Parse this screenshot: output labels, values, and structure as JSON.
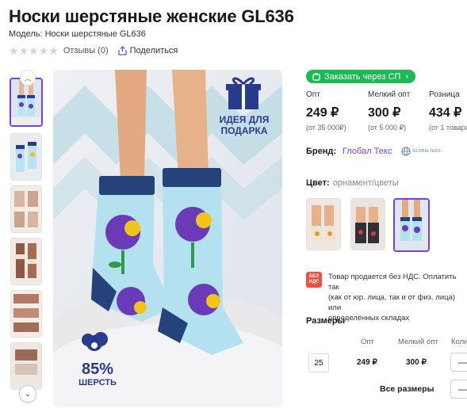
{
  "product": {
    "title": "Носки шерстяные женские GL636",
    "model": "Модель: Носки шерстяные GL636",
    "reviews": "Отзывы (0)",
    "share": "Поделиться",
    "rating_stars": 0
  },
  "gallery": {
    "thumbnail_count": 7,
    "up_icon": "chevron-up-icon",
    "down_icon": "chevron-down-icon"
  },
  "main_image": {
    "gift_text_line1": "ИДЕЯ ДЛЯ",
    "gift_text_line2": "ПОДАРКА",
    "wool_percent": "85%",
    "wool_label": "ШЕРСТЬ"
  },
  "order": {
    "sp_button": "Заказать через СП"
  },
  "prices": [
    {
      "label": "Опт",
      "value": "249 ₽",
      "note": "(от 35 000₽)"
    },
    {
      "label": "Мелкий опт",
      "value": "300 ₽",
      "note": "(от 5 000 ₽)"
    },
    {
      "label": "Розница",
      "value": "434 ₽",
      "note": "(от 1 товара)"
    }
  ],
  "brand": {
    "label": "Бренд:",
    "name": "Глобал Текс",
    "logo_text": "GLOBALTEKS"
  },
  "color": {
    "label": "Цвет:",
    "value": "орнамент/цветы"
  },
  "vat": {
    "icon_text1": "БЕЗ",
    "icon_text2": "НДС",
    "line1": "Товар продается без НДС. Оплатить так",
    "line2": "(как от юр. лица, так и от физ. лица) или",
    "line3": "определённых складах"
  },
  "sizes": {
    "heading": "Размеры",
    "columns": [
      "Опт",
      "Мелкий опт",
      "Коли"
    ],
    "rows": [
      {
        "size": "25",
        "opt": "249 ₽",
        "small_opt": "300 ₽",
        "qty": "—"
      }
    ],
    "all_sizes_label": "Все размеры",
    "all_sizes_qty": "—"
  },
  "colors": {
    "accent": "#7a3fe0",
    "green": "#1db954",
    "navy": "#2a3a8c"
  }
}
